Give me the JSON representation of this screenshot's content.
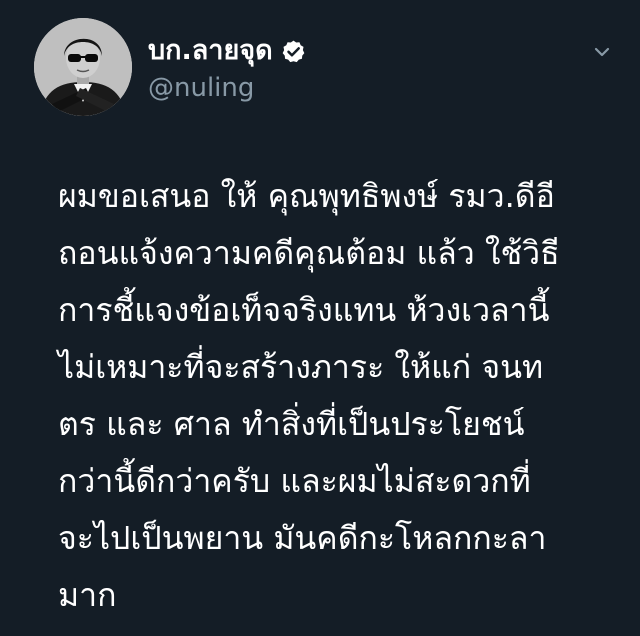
{
  "tweet": {
    "display_name": "บก.ลายจุด",
    "handle": "@nuling",
    "verified": true,
    "text_lines": [
      "ผมขอเสนอ ให้ คุณพุทธิพงษ์  รมว.ดีอี",
      "ถอนแจ้งความคดีคุณต้อม แล้ว ใช้วิธี",
      "การชี้แจงข้อเท็จจริงแทน ห้วงเวลานี้",
      "ไม่เหมาะที่จะสร้างภาระ ให้แก่ จนท",
      "ตร และ ศาล ทำสิ่งที่เป็นประโยชน์",
      "กว่านี้ดีกว่าครับ และผมไม่สะดวกที่",
      "จะไปเป็นพยาน มันคดีกะโหลกกะลา",
      "มาก"
    ]
  },
  "icons": {
    "verified": "verified-badge-icon",
    "menu": "chevron-down-icon"
  },
  "colors": {
    "background": "#141d26",
    "name": "#ffffff",
    "handle": "#8899a6",
    "text": "#ffffff",
    "caret": "#8899a6"
  }
}
